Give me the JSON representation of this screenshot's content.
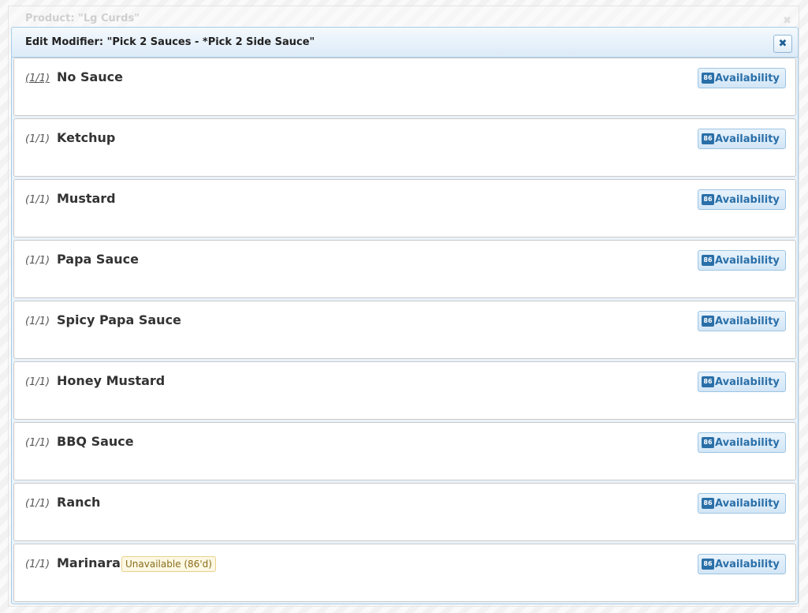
{
  "product_dialog": {
    "title": "Product: \"Lg Curds\"",
    "close_glyph": "✖"
  },
  "modifier_dialog": {
    "title": "Edit Modifier: \"Pick 2 Sauces - *Pick 2 Side Sauce\"",
    "close_glyph": "✖"
  },
  "items": [
    {
      "count": "(1/1)",
      "name": "No Sauce",
      "badge": "86",
      "button": "Availability"
    },
    {
      "count": "(1/1)",
      "name": "Ketchup",
      "badge": "86",
      "button": "Availability"
    },
    {
      "count": "(1/1)",
      "name": "Mustard",
      "badge": "86",
      "button": "Availability"
    },
    {
      "count": "(1/1)",
      "name": "Papa Sauce",
      "badge": "86",
      "button": "Availability"
    },
    {
      "count": "(1/1)",
      "name": "Spicy Papa Sauce",
      "badge": "86",
      "button": "Availability"
    },
    {
      "count": "(1/1)",
      "name": "Honey Mustard",
      "badge": "86",
      "button": "Availability"
    },
    {
      "count": "(1/1)",
      "name": "BBQ Sauce",
      "badge": "86",
      "button": "Availability"
    },
    {
      "count": "(1/1)",
      "name": "Ranch",
      "badge": "86",
      "button": "Availability"
    },
    {
      "count": "(1/1)",
      "name": "Marinara",
      "status": "Unavailable (86'd)",
      "badge": "86",
      "button": "Availability"
    }
  ],
  "colors": {
    "accent": "#2a6fa8",
    "unavailable_bg": "#fcf8e3",
    "unavailable_text": "#8a6d1c"
  }
}
